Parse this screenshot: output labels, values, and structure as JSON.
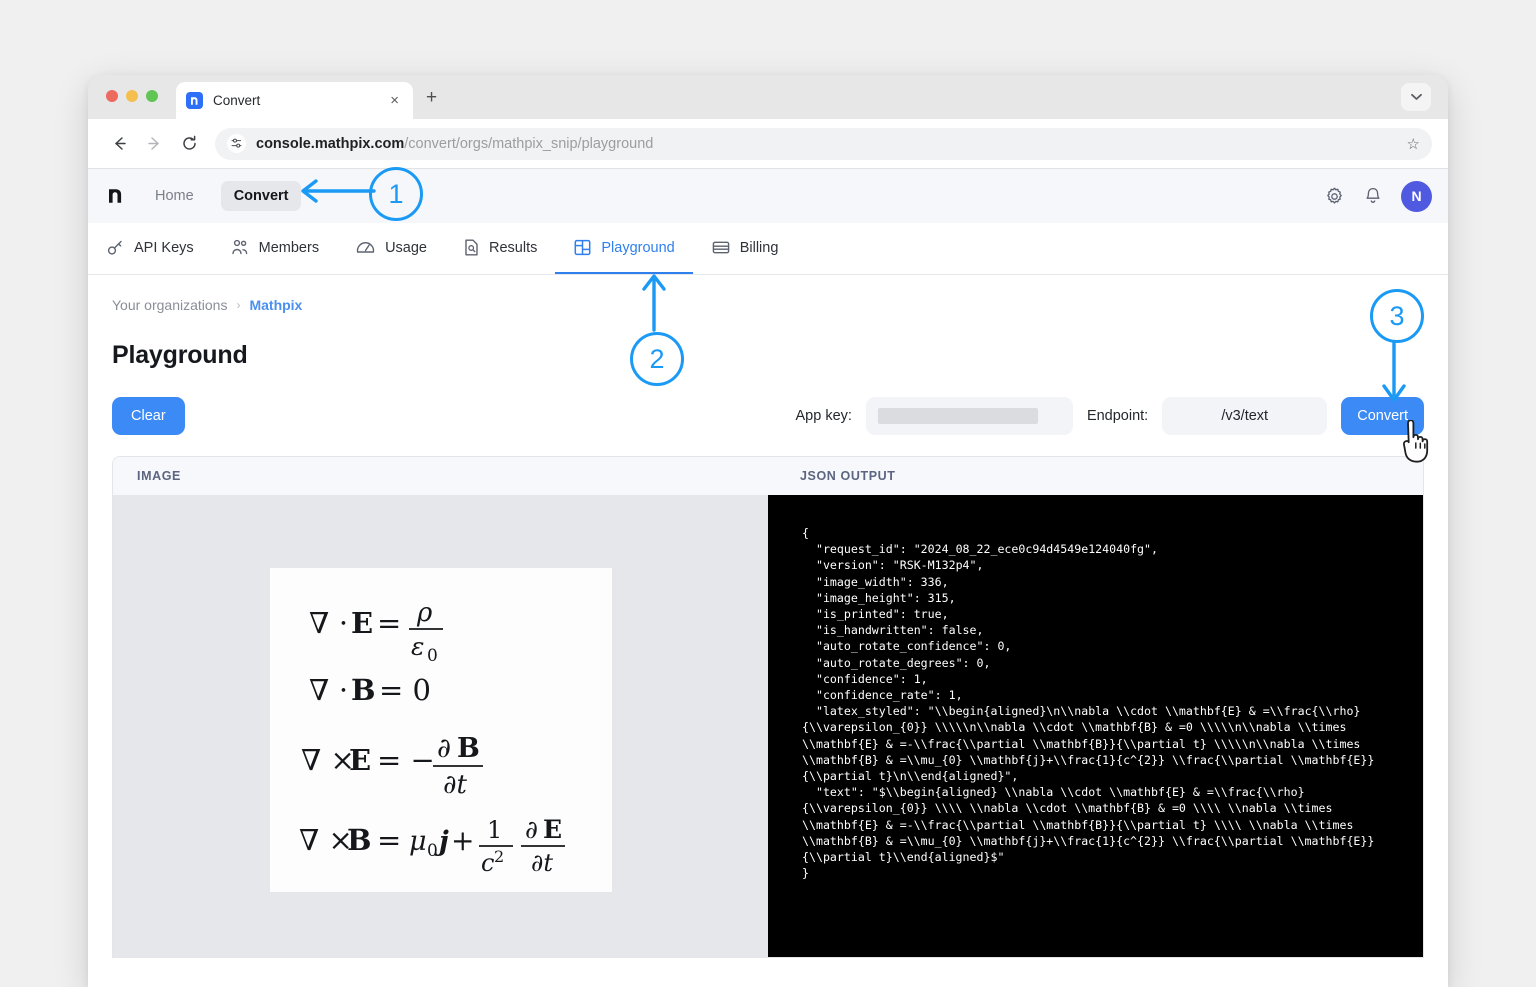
{
  "browser": {
    "tab": {
      "title": "Convert",
      "favicon_letter": "m",
      "close_label": "×"
    },
    "new_tab_label": "+",
    "tab_list_chevron": "chevron-down",
    "nav": {
      "back": "←",
      "forward": "→",
      "reload": "⟳"
    },
    "url": {
      "host": "console.mathpix.com",
      "path": "/convert/orgs/mathpix_snip/playground"
    },
    "bookmark_star": "☆"
  },
  "app_header": {
    "logo": "m",
    "links": [
      {
        "label": "Home",
        "active": false
      },
      {
        "label": "Convert",
        "active": true
      }
    ],
    "icons": [
      {
        "name": "settings-gear-icon"
      },
      {
        "name": "notifications-bell-icon"
      }
    ],
    "avatar_initial": "N"
  },
  "app_tabs": [
    {
      "label": "API Keys",
      "icon": "key-icon",
      "active": false
    },
    {
      "label": "Members",
      "icon": "people-icon",
      "active": false
    },
    {
      "label": "Usage",
      "icon": "gauge-icon",
      "active": false
    },
    {
      "label": "Results",
      "icon": "document-search-icon",
      "active": false
    },
    {
      "label": "Playground",
      "icon": "layout-panels-icon",
      "active": true
    },
    {
      "label": "Billing",
      "icon": "card-icon",
      "active": false
    }
  ],
  "breadcrumb": {
    "root": "Your organizations",
    "separator": "›",
    "current": "Mathpix"
  },
  "page": {
    "title": "Playground"
  },
  "toolbar": {
    "clear_label": "Clear",
    "app_key_label": "App key:",
    "app_key_value": "",
    "app_key_redacted": true,
    "endpoint_label": "Endpoint:",
    "endpoint_value": "/v3/text",
    "convert_label": "Convert"
  },
  "panels": {
    "image_header": "IMAGE",
    "json_header": "JSON OUTPUT",
    "image_equations": [
      "∇ · E = ρ / ε₀",
      "∇ · B = 0",
      "∇ × E = − ∂B / ∂t",
      "∇ × B = μ₀ j + (1/c²) ∂E / ∂t"
    ],
    "json_output": "{\n  \"request_id\": \"2024_08_22_ece0c94d4549e124040fg\",\n  \"version\": \"RSK-M132p4\",\n  \"image_width\": 336,\n  \"image_height\": 315,\n  \"is_printed\": true,\n  \"is_handwritten\": false,\n  \"auto_rotate_confidence\": 0,\n  \"auto_rotate_degrees\": 0,\n  \"confidence\": 1,\n  \"confidence_rate\": 1,\n  \"latex_styled\": \"\\\\begin{aligned}\\n\\\\nabla \\\\cdot \\\\mathbf{E} & =\\\\frac{\\\\rho}{\\\\varepsilon_{0}} \\\\\\\\\\n\\\\nabla \\\\cdot \\\\mathbf{B} & =0 \\\\\\\\\\n\\\\nabla \\\\times \\\\mathbf{E} & =-\\\\frac{\\\\partial \\\\mathbf{B}}{\\\\partial t} \\\\\\\\\\n\\\\nabla \\\\times \\\\mathbf{B} & =\\\\mu_{0} \\\\mathbf{j}+\\\\frac{1}{c^{2}} \\\\frac{\\\\partial \\\\mathbf{E}}{\\\\partial t}\\n\\\\end{aligned}\",\n  \"text\": \"$\\\\begin{aligned} \\\\nabla \\\\cdot \\\\mathbf{E} & =\\\\frac{\\\\rho}{\\\\varepsilon_{0}} \\\\\\\\ \\\\nabla \\\\cdot \\\\mathbf{B} & =0 \\\\\\\\ \\\\nabla \\\\times \\\\mathbf{E} & =-\\\\frac{\\\\partial \\\\mathbf{B}}{\\\\partial t} \\\\\\\\ \\\\nabla \\\\times \\\\mathbf{B} & =\\\\mu_{0} \\\\mathbf{j}+\\\\frac{1}{c^{2}} \\\\frac{\\\\partial \\\\mathbf{E}}{\\\\partial t}\\\\end{aligned}$\"\n}"
  },
  "annotations": [
    {
      "id": "1",
      "label": "1",
      "target": "convert-nav-link"
    },
    {
      "id": "2",
      "label": "2",
      "target": "tab-playground"
    },
    {
      "id": "3",
      "label": "3",
      "target": "convert-button"
    }
  ],
  "colors": {
    "accent_blue": "#3b8af5",
    "annotation_blue": "#1a9af5",
    "avatar_purple": "#4f5ae0",
    "json_background": "#000000"
  }
}
